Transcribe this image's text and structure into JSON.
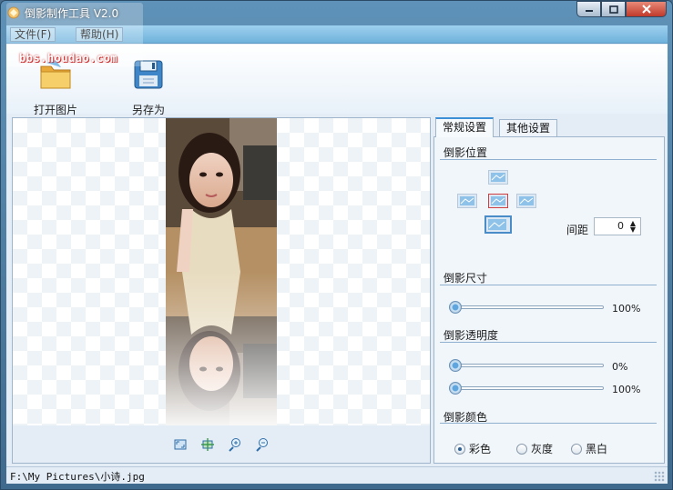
{
  "window": {
    "title": "倒影制作工具 V2.0",
    "watermark_url": "bbs.houdao.com"
  },
  "menu": {
    "items": [
      {
        "label": "文件(F)"
      },
      {
        "label": "帮助(H)"
      }
    ]
  },
  "toolbar": {
    "open_label": "打开图片",
    "save_as_label": "另存为"
  },
  "preview_tools": [
    {
      "name": "fit-window-icon"
    },
    {
      "name": "actual-size-icon"
    },
    {
      "name": "zoom-in-icon"
    },
    {
      "name": "zoom-out-icon"
    }
  ],
  "tabs": [
    {
      "label": "常规设置",
      "active": true
    },
    {
      "label": "其他设置",
      "active": false
    }
  ],
  "settings": {
    "position_title": "倒影位置",
    "spacing_label": "间距",
    "spacing_value": "0",
    "size_title": "倒影尺寸",
    "size_value": "100%",
    "size_level": 0.0,
    "opacity_title": "倒影透明度",
    "opacity_start_value": "0%",
    "opacity_start_level": 0.0,
    "opacity_end_value": "100%",
    "opacity_end_level": 0.0,
    "color_title": "倒影颜色",
    "color_options": [
      {
        "label": "彩色",
        "checked": true
      },
      {
        "label": "灰度",
        "checked": false
      },
      {
        "label": "黑白",
        "checked": false
      }
    ]
  },
  "status": {
    "path": "F:\\My Pictures\\小诗.jpg"
  },
  "colors": {
    "accent": "#3d8fd6",
    "menubar": "#6fb2dc",
    "panel_bg": "#e4edf6"
  }
}
